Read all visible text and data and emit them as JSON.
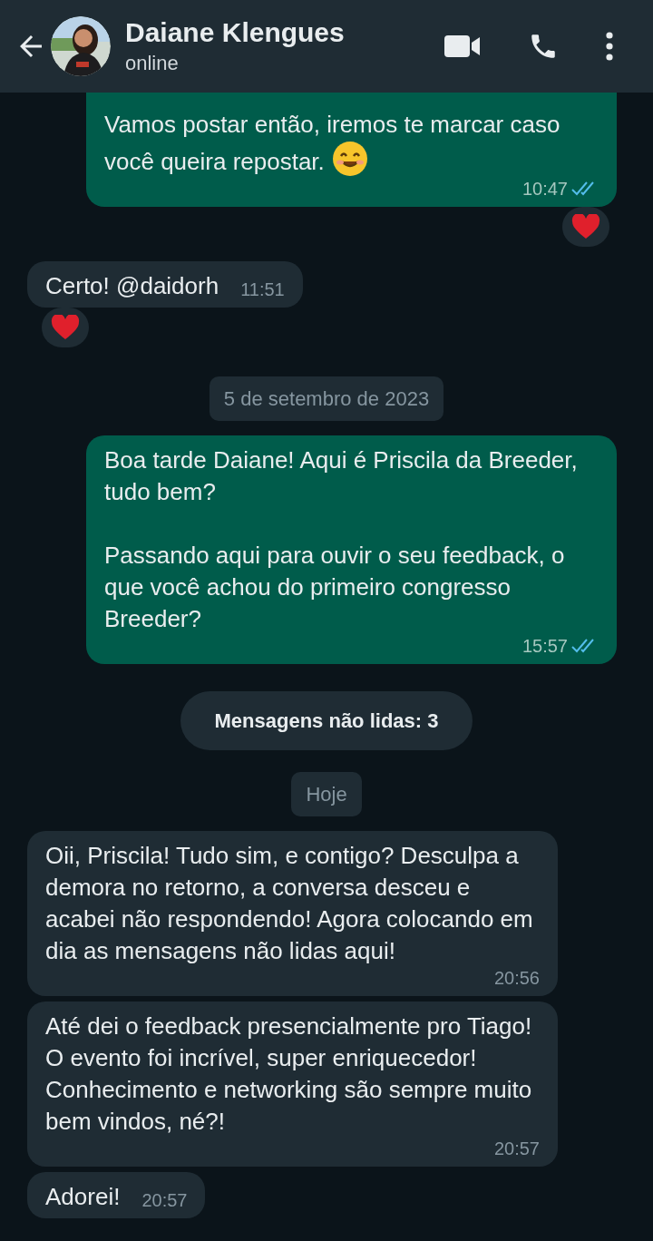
{
  "header": {
    "name": "Daiane Klengues",
    "status": "online"
  },
  "items": [
    {
      "kind": "outgoing",
      "text": "Vamos postar então, iremos te marcar caso você queira repostar.",
      "emoji": true,
      "time": "10:47",
      "read": true,
      "reaction": true,
      "cut_top": true
    },
    {
      "kind": "incoming",
      "text": "Certo! @daidorh",
      "time": "11:51",
      "reaction": true
    },
    {
      "kind": "date",
      "text": "5 de setembro de 2023"
    },
    {
      "kind": "outgoing",
      "text": "Boa tarde Daiane! Aqui é Priscila da Breeder, tudo bem?\n\nPassando aqui para ouvir o seu feedback, o que você achou do primeiro congresso Breeder?",
      "time": "15:57",
      "read": true,
      "reaction": false
    },
    {
      "kind": "unread",
      "text": "Mensagens não lidas: 3"
    },
    {
      "kind": "date",
      "text": "Hoje"
    },
    {
      "kind": "incoming",
      "text": "Oii, Priscila! Tudo sim, e contigo? Desculpa a demora no retorno, a conversa desceu e acabei não respondendo! Agora colocando em dia as mensagens não lidas aqui!",
      "time": "20:56",
      "reaction": false
    },
    {
      "kind": "incoming",
      "text": "Até dei o feedback presencialmente pro Tiago! O evento foi incrível, super enriquecedor! Conhecimento e networking são sempre muito bem vindos, né?!",
      "time": "20:57",
      "reaction": false
    },
    {
      "kind": "incoming",
      "text": "Adorei!",
      "time": "20:57",
      "reaction": false
    }
  ]
}
